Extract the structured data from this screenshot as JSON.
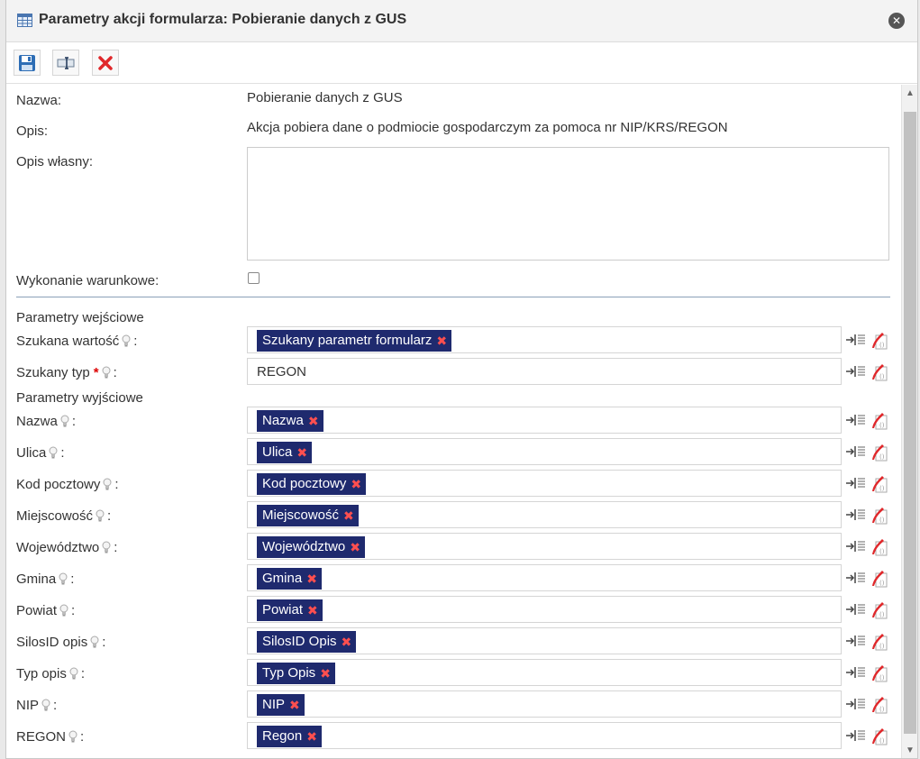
{
  "dialog": {
    "title": "Parametry akcji formularza: Pobieranie danych z GUS",
    "title_icon": "table-icon",
    "close_icon": "close-icon"
  },
  "toolbar": {
    "buttons": [
      {
        "name": "save",
        "icon": "floppy-disk-icon"
      },
      {
        "name": "rename",
        "icon": "text-field-icon"
      },
      {
        "name": "delete",
        "icon": "red-x-icon"
      }
    ]
  },
  "form": {
    "name_label": "Nazwa:",
    "name_value": "Pobieranie danych z GUS",
    "desc_label": "Opis:",
    "desc_value": "Akcja pobiera dane o podmiocie gospodarczym za pomoca nr NIP/KRS/REGON",
    "own_desc_label": "Opis własny:",
    "own_desc_value": "",
    "conditional_label": "Wykonanie warunkowe:",
    "conditional_checked": false,
    "input_section": "Parametry wejściowe",
    "output_section": "Parametry wyjściowe"
  },
  "inputs": [
    {
      "label": "Szukana wartość",
      "chip": "Szukany parametr formularz",
      "required": false
    },
    {
      "label": "Szukany typ",
      "plain": "REGON",
      "required": true
    }
  ],
  "outputs": [
    {
      "label": "Nazwa",
      "chip": "Nazwa"
    },
    {
      "label": "Ulica",
      "chip": "Ulica"
    },
    {
      "label": "Kod pocztowy",
      "chip": "Kod pocztowy"
    },
    {
      "label": "Miejscowość",
      "chip": "Miejscowość"
    },
    {
      "label": "Województwo",
      "chip": "Województwo"
    },
    {
      "label": "Gmina",
      "chip": "Gmina"
    },
    {
      "label": "Powiat",
      "chip": "Powiat"
    },
    {
      "label": "SilosID opis",
      "chip": "SilosID Opis"
    },
    {
      "label": "Typ opis",
      "chip": "Typ Opis"
    },
    {
      "label": "NIP",
      "chip": "NIP"
    },
    {
      "label": "REGON",
      "chip": "Regon"
    }
  ],
  "symbols": {
    "colon": ":",
    "required_mark": "*",
    "chip_remove": "✖"
  },
  "colors": {
    "chip_bg": "#1f2a6e",
    "chip_x": "#ff4f4f",
    "required": "#d00"
  }
}
